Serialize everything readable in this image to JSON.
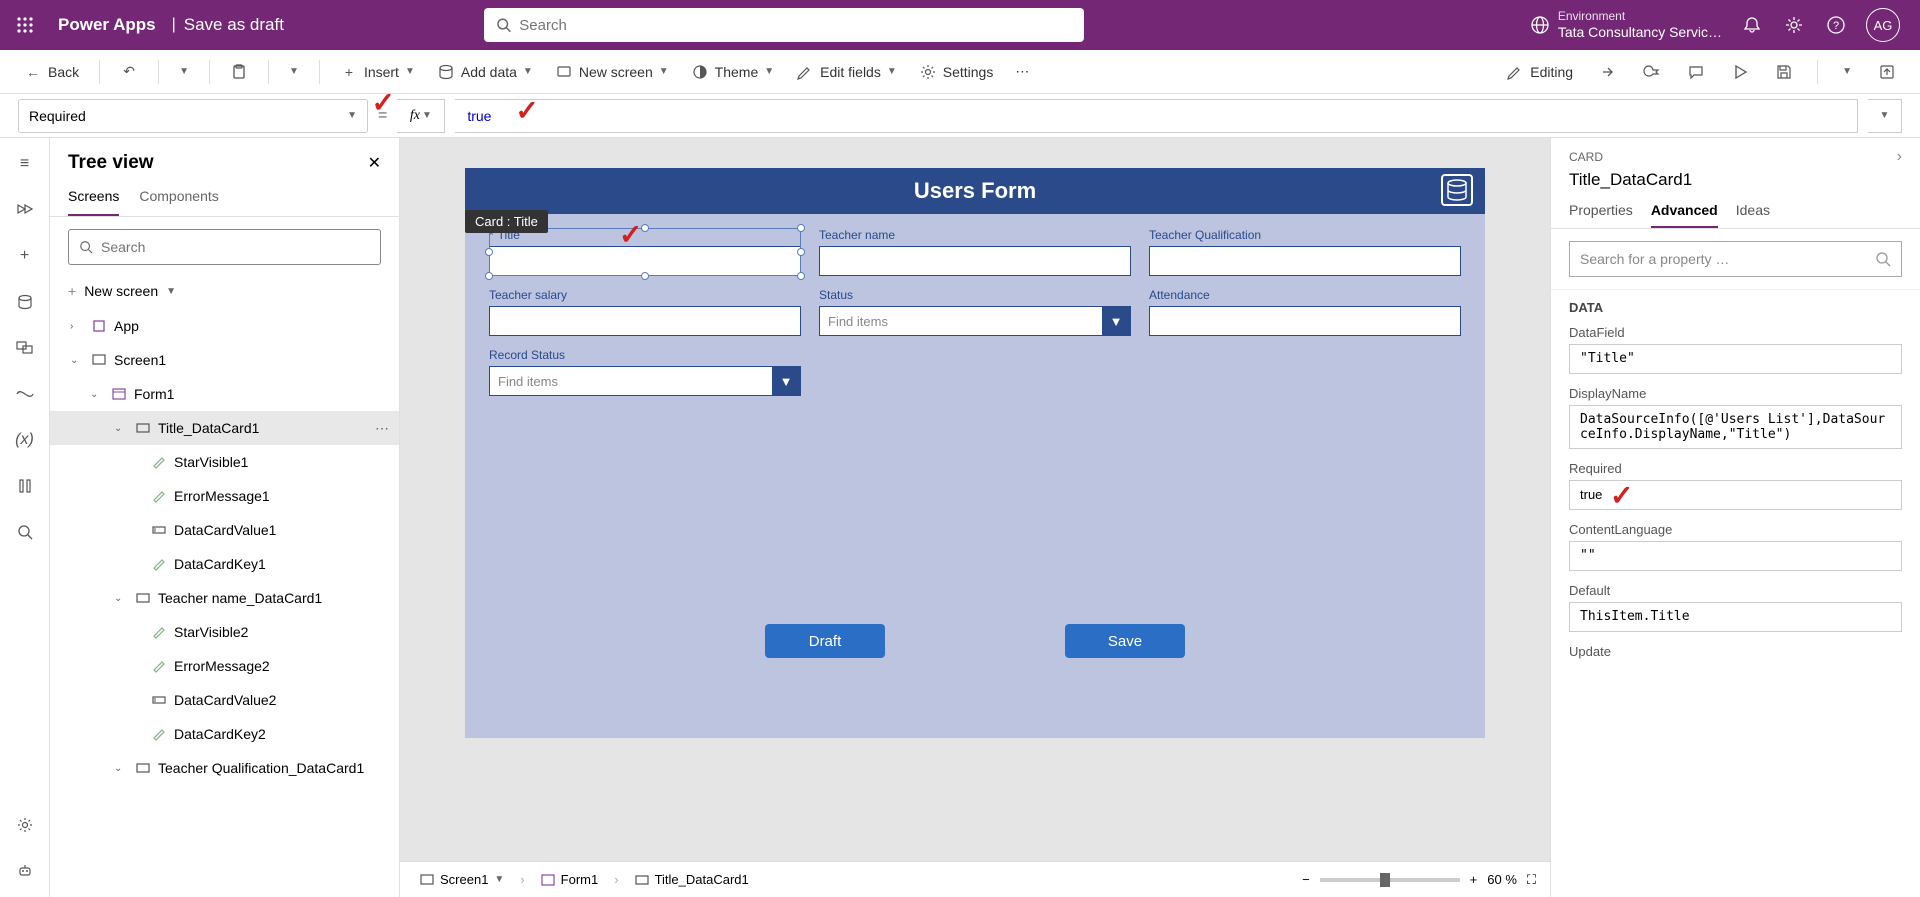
{
  "header": {
    "app_title": "Power Apps",
    "page_name": "Save as draft",
    "search_placeholder": "Search",
    "env_label": "Environment",
    "env_name": "Tata Consultancy Servic…",
    "avatar": "AG"
  },
  "commandBar": {
    "back": "Back",
    "insert": "Insert",
    "addData": "Add data",
    "newScreen": "New screen",
    "theme": "Theme",
    "editFields": "Edit fields",
    "settings": "Settings",
    "editing": "Editing"
  },
  "formulaBar": {
    "property": "Required",
    "value": "true"
  },
  "treeView": {
    "title": "Tree view",
    "tabScreens": "Screens",
    "tabComponents": "Components",
    "searchPlaceholder": "Search",
    "newScreen": "New screen",
    "items": {
      "app": "App",
      "screen1": "Screen1",
      "form1": "Form1",
      "titleCard": "Title_DataCard1",
      "starVisible1": "StarVisible1",
      "errorMessage1": "ErrorMessage1",
      "dataCardValue1": "DataCardValue1",
      "dataCardKey1": "DataCardKey1",
      "teacherNameCard": "Teacher name_DataCard1",
      "starVisible2": "StarVisible2",
      "errorMessage2": "ErrorMessage2",
      "dataCardValue2": "DataCardValue2",
      "dataCardKey2": "DataCardKey2",
      "teacherQualCard": "Teacher Qualification_DataCard1"
    }
  },
  "canvas": {
    "tooltip": "Card : Title",
    "formTitle": "Users Form",
    "fields": {
      "title": "Title",
      "teacherName": "Teacher name",
      "teacherQual": "Teacher Qualification",
      "teacherSalary": "Teacher salary",
      "status": "Status",
      "attendance": "Attendance",
      "recordStatus": "Record Status",
      "findItems": "Find items"
    },
    "buttons": {
      "draft": "Draft",
      "save": "Save"
    }
  },
  "breadcrumb": {
    "screen1": "Screen1",
    "form1": "Form1",
    "titleCard": "Title_DataCard1",
    "zoom": "60 %"
  },
  "props": {
    "type": "CARD",
    "name": "Title_DataCard1",
    "tabProperties": "Properties",
    "tabAdvanced": "Advanced",
    "tabIdeas": "Ideas",
    "searchPlaceholder": "Search for a property …",
    "sectionData": "DATA",
    "fields": {
      "dataFieldLabel": "DataField",
      "dataFieldValue": "\"Title\"",
      "displayNameLabel": "DisplayName",
      "displayNameValue": "DataSourceInfo([@'Users List'],DataSourceInfo.DisplayName,\"Title\")",
      "requiredLabel": "Required",
      "requiredValue": "true",
      "contentLangLabel": "ContentLanguage",
      "contentLangValue": "\"\"",
      "defaultLabel": "Default",
      "defaultValue": "ThisItem.Title",
      "updateLabel": "Update"
    }
  }
}
